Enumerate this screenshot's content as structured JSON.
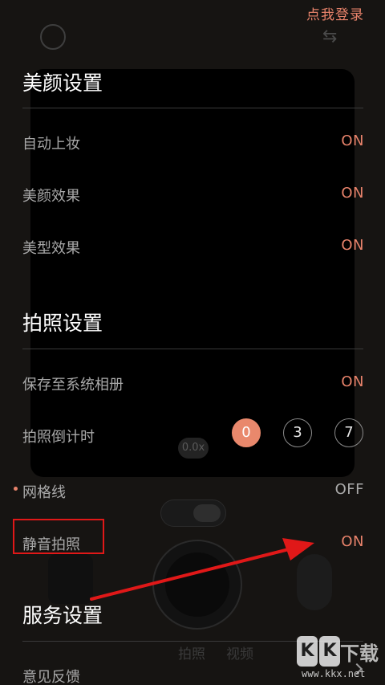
{
  "header": {
    "login_link": "点我登录"
  },
  "camera_background": {
    "zoom_label": "0.0x",
    "mode_labels": [
      "拍照",
      "视频"
    ]
  },
  "sections": {
    "beauty": {
      "title": "美颜设置",
      "rows": [
        {
          "label": "自动上妆",
          "value": "ON"
        },
        {
          "label": "美颜效果",
          "value": "ON"
        },
        {
          "label": "美型效果",
          "value": "ON"
        }
      ]
    },
    "photo": {
      "title": "拍照设置",
      "save_row": {
        "label": "保存至系统相册",
        "value": "ON"
      },
      "timer_row": {
        "label": "拍照倒计时",
        "options": [
          "0",
          "3",
          "7"
        ],
        "selected": "0"
      },
      "grid_row": {
        "label": "网格线",
        "value": "OFF"
      },
      "mute_row": {
        "label": "静音拍照",
        "value": "ON"
      }
    },
    "service": {
      "title": "服务设置",
      "rows": [
        {
          "label": "意见反馈"
        }
      ]
    }
  },
  "annotation": {
    "highlight_color": "#e01818",
    "arrow_color": "#e01818"
  },
  "watermark": {
    "badge": [
      "K",
      "K"
    ],
    "cn": "下载",
    "url": "www.kkx.net"
  },
  "colors": {
    "accent": "#e8836b",
    "text_dim": "#a9a9a9",
    "background": "#161412"
  },
  "icons": {
    "top_left": "face-icon",
    "top_right": "camera-switch-icon",
    "feedback": "chevron-right-icon"
  }
}
